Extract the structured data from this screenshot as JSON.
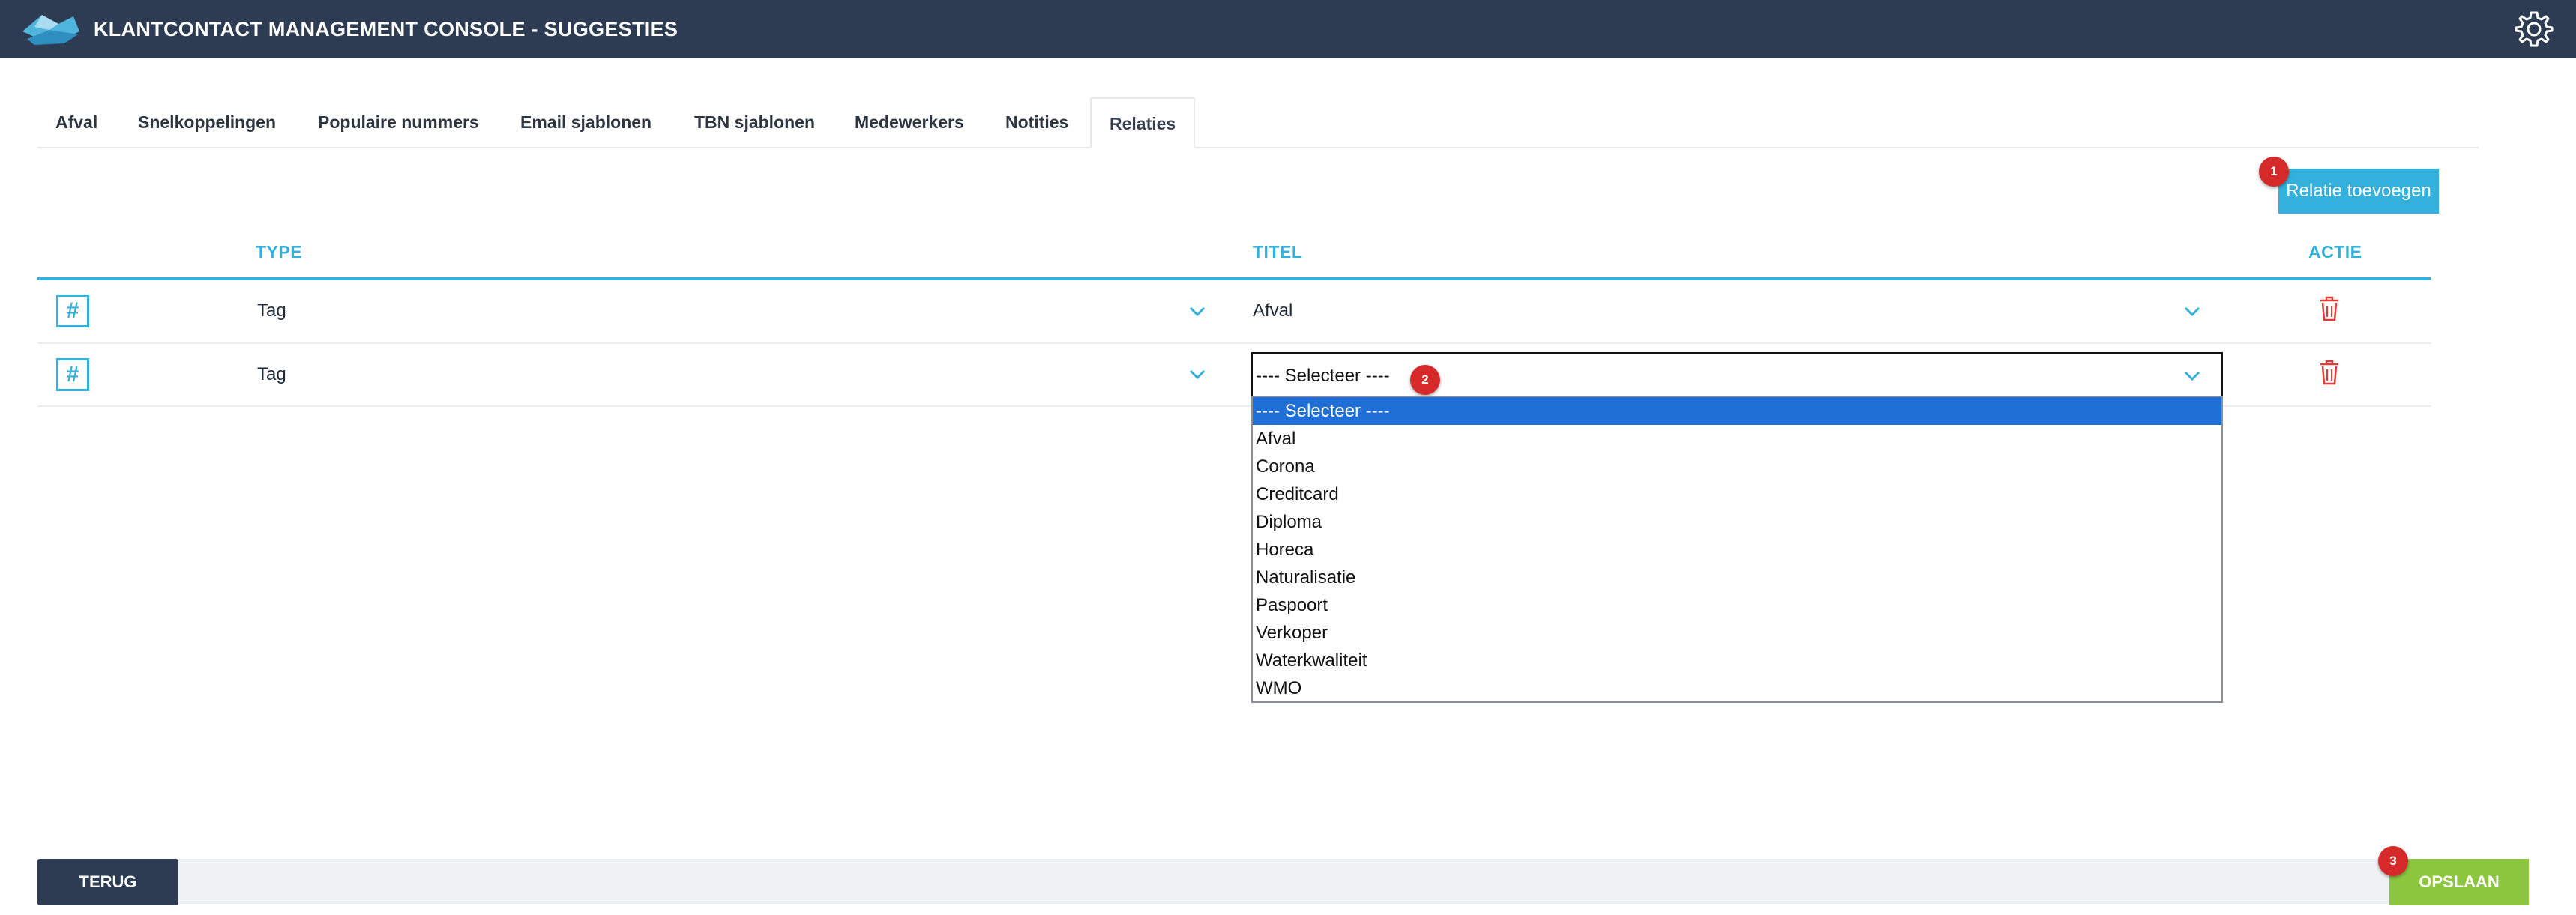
{
  "header": {
    "title": "KLANTCONTACT MANAGEMENT CONSOLE - SUGGESTIES",
    "logo_icon": "cloud-logo-icon",
    "settings_icon": "gear-icon"
  },
  "tabs": [
    {
      "label": "Afval",
      "active": false
    },
    {
      "label": "Snelkoppelingen",
      "active": false
    },
    {
      "label": "Populaire nummers",
      "active": false
    },
    {
      "label": "Email sjablonen",
      "active": false
    },
    {
      "label": "TBN sjablonen",
      "active": false
    },
    {
      "label": "Medewerkers",
      "active": false
    },
    {
      "label": "Notities",
      "active": false
    },
    {
      "label": "Relaties",
      "active": true
    }
  ],
  "add_button": {
    "label": "Relatie toevoegen",
    "badge": "1"
  },
  "table": {
    "columns": {
      "type": "TYPE",
      "title": "TITEL",
      "action": "ACTIE"
    },
    "rows": [
      {
        "icon": "hash-icon",
        "type": "Tag",
        "title": "Afval",
        "action_icon": "trash-icon"
      },
      {
        "icon": "hash-icon",
        "type": "Tag",
        "title": "---- Selecteer ----",
        "action_icon": "trash-icon",
        "badge": "2"
      }
    ]
  },
  "dropdown": {
    "selected": "---- Selecteer ----",
    "options": [
      "---- Selecteer ----",
      "Afval",
      "Corona",
      "Creditcard",
      "Diploma",
      "Horeca",
      "Naturalisatie",
      "Paspoort",
      "Verkoper",
      "Waterkwaliteit",
      "WMO"
    ]
  },
  "footer": {
    "back_label": "TERUG",
    "save_label": "OPSLAAN",
    "save_badge": "3"
  },
  "colors": {
    "header_bg": "#2d3c52",
    "accent": "#33b1dc",
    "danger": "#d62a2a",
    "save": "#8cc63f",
    "option_highlight": "#1f6fd6"
  }
}
